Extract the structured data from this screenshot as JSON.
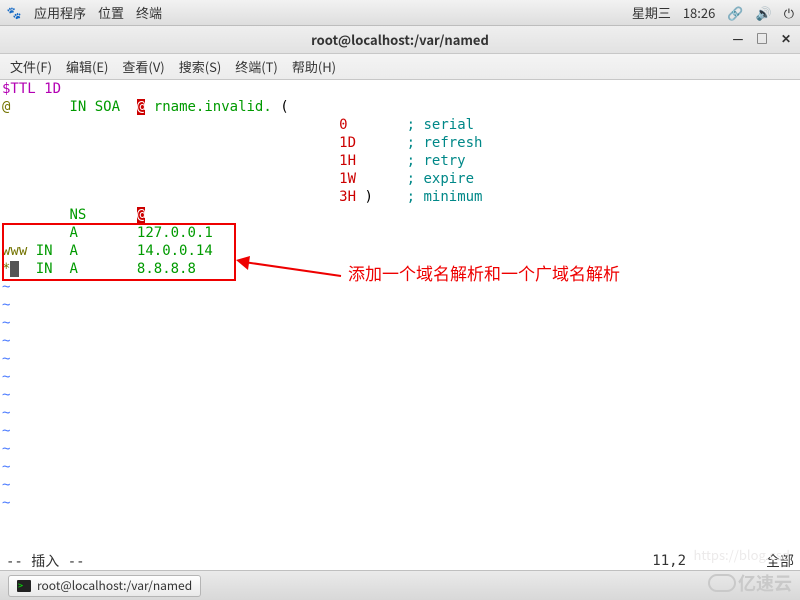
{
  "panel": {
    "menu": {
      "apps": "应用程序",
      "places": "位置",
      "terminal": "终端"
    },
    "day": "星期三",
    "time": "18:26"
  },
  "window": {
    "title": "root@localhost:/var/named"
  },
  "menubar": {
    "file": "文件(F)",
    "edit": "编辑(E)",
    "view": "查看(V)",
    "search": "搜索(S)",
    "terminal": "终端(T)",
    "help": "帮助(H)"
  },
  "zone": {
    "ttl_kw": "$TTL",
    "ttl_val": "1D",
    "origin": "@",
    "in": "IN",
    "soa": "SOA",
    "rname": "rname.invalid.",
    "soa_fields": [
      {
        "val": "0",
        "comment": "serial"
      },
      {
        "val": "1D",
        "comment": "refresh"
      },
      {
        "val": "1H",
        "comment": "retry"
      },
      {
        "val": "1W",
        "comment": "expire"
      },
      {
        "val": "3H",
        "comment": "minimum"
      }
    ],
    "ns_type": "NS",
    "ns_val": "@",
    "a_type": "A",
    "a_root": "127.0.0.1",
    "www_name": "www",
    "www_in": "IN",
    "www_type": "A",
    "www_val": "14.0.0.14",
    "wild_name": "*",
    "wild_in": "IN",
    "wild_type": "A",
    "wild_val": "8.8.8.8",
    "close_paren": ")",
    "semi": ";"
  },
  "annotation": {
    "text": "添加一个域名解析和一个广域名解析"
  },
  "status": {
    "mode": "-- 插入 --",
    "pos": "11,2",
    "pct": "全部"
  },
  "taskbar": {
    "task1": "root@localhost:/var/named"
  },
  "watermark": {
    "blog": "https://blog.csd",
    "brand": "亿速云"
  }
}
